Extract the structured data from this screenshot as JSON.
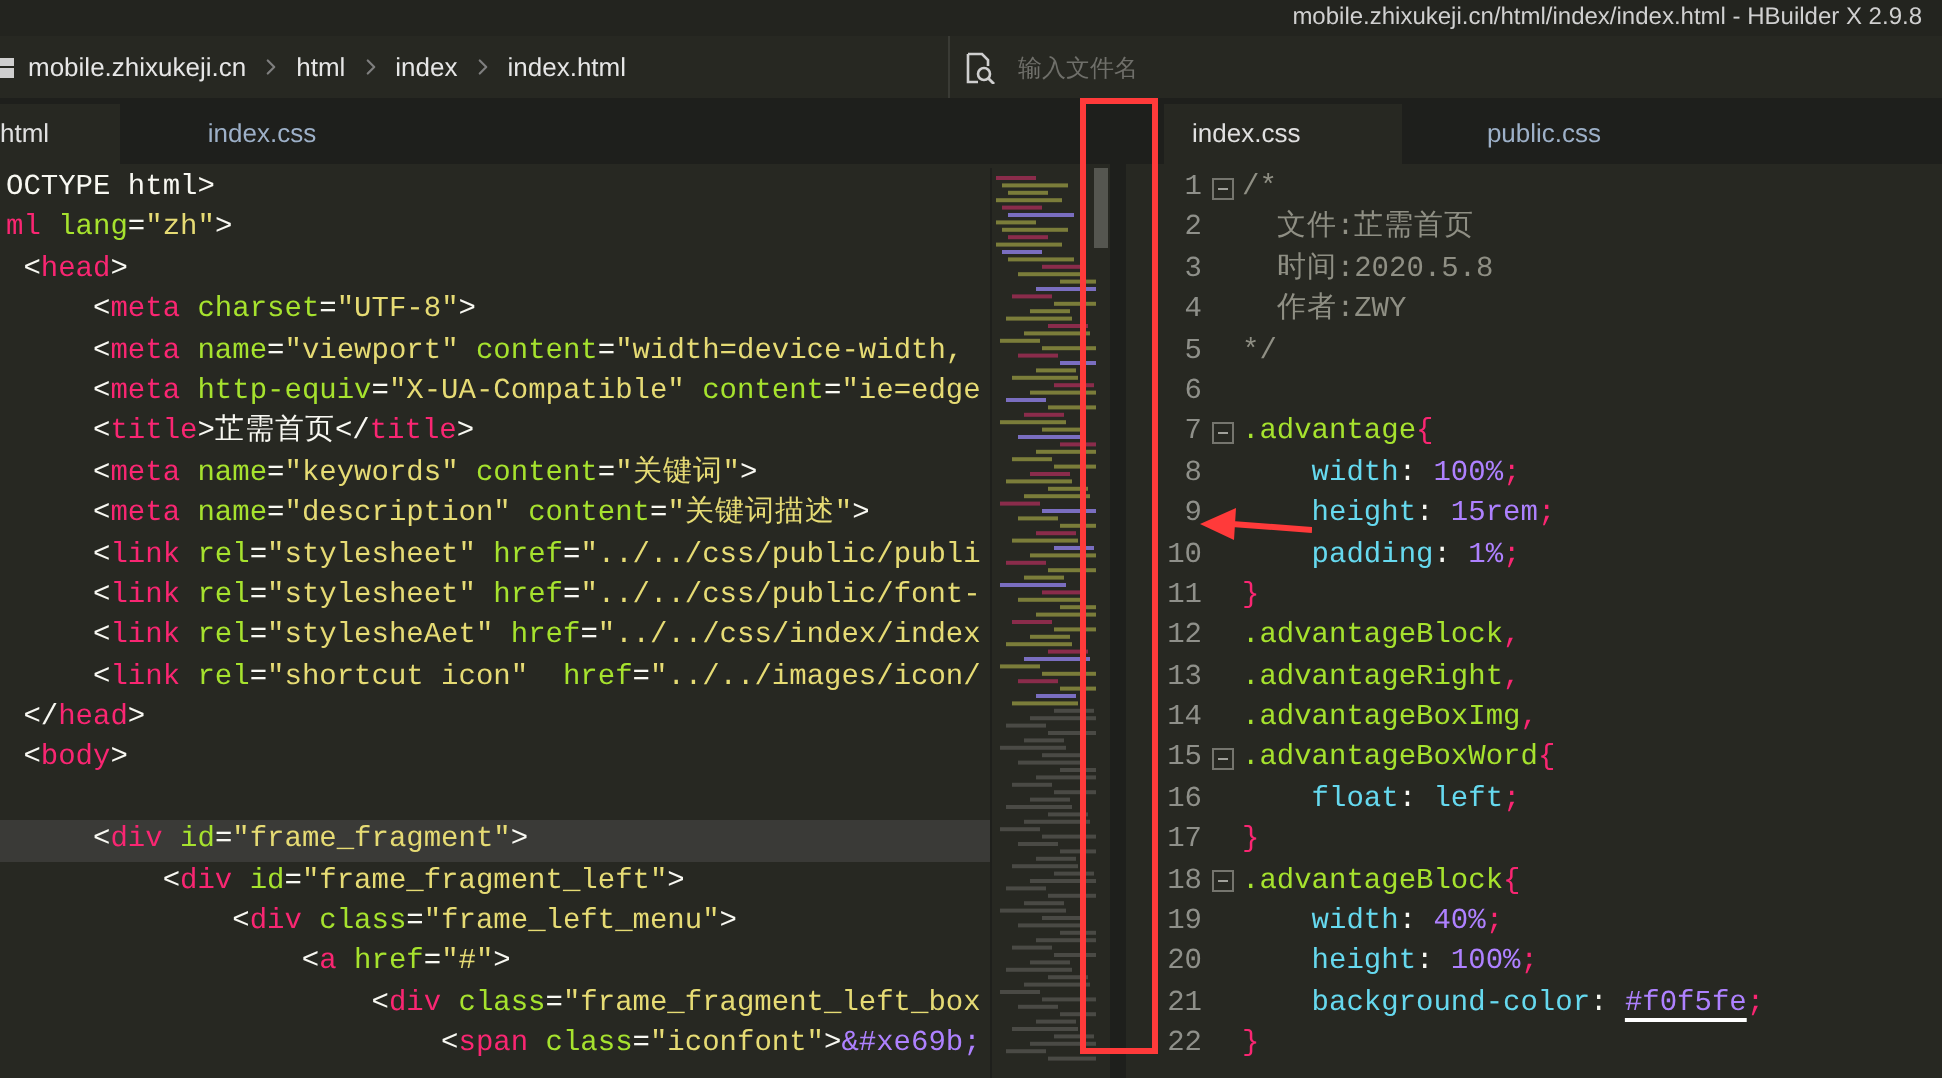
{
  "window": {
    "title": "mobile.zhixukeji.cn/html/index/index.html - HBuilder X 2.9.8"
  },
  "breadcrumb": {
    "items": [
      "mobile.zhixukeji.cn",
      "html",
      "index",
      "index.html"
    ]
  },
  "file_search": {
    "placeholder": "输入文件名"
  },
  "left_editor": {
    "tabs": [
      {
        "label": "html",
        "selected": true
      },
      {
        "label": "index.css",
        "selected": false
      }
    ],
    "lines": [
      {
        "current": false,
        "tokens": [
          {
            "kind": "txt",
            "text": "OCTYPE html>"
          }
        ]
      },
      {
        "current": false,
        "tokens": [
          {
            "kind": "tag",
            "text": "ml"
          },
          {
            "kind": "attr",
            "text": " lang"
          },
          {
            "kind": "p",
            "text": "="
          },
          {
            "kind": "str",
            "text": "\"zh\""
          },
          {
            "kind": "p",
            "text": ">"
          }
        ]
      },
      {
        "current": false,
        "tokens": [
          {
            "kind": "p",
            "text": " <"
          },
          {
            "kind": "tag",
            "text": "head"
          },
          {
            "kind": "p",
            "text": ">"
          }
        ]
      },
      {
        "current": false,
        "tokens": [
          {
            "kind": "p",
            "text": "     <"
          },
          {
            "kind": "tag",
            "text": "meta"
          },
          {
            "kind": "attr",
            "text": " charset"
          },
          {
            "kind": "p",
            "text": "="
          },
          {
            "kind": "str",
            "text": "\"UTF-8\""
          },
          {
            "kind": "p",
            "text": ">"
          }
        ]
      },
      {
        "current": false,
        "tokens": [
          {
            "kind": "p",
            "text": "     <"
          },
          {
            "kind": "tag",
            "text": "meta"
          },
          {
            "kind": "attr",
            "text": " name"
          },
          {
            "kind": "p",
            "text": "="
          },
          {
            "kind": "str",
            "text": "\"viewport\""
          },
          {
            "kind": "attr",
            "text": " content"
          },
          {
            "kind": "p",
            "text": "="
          },
          {
            "kind": "str",
            "text": "\"width=device-width,"
          }
        ]
      },
      {
        "current": false,
        "tokens": [
          {
            "kind": "p",
            "text": "     <"
          },
          {
            "kind": "tag",
            "text": "meta"
          },
          {
            "kind": "attr",
            "text": " http-equiv"
          },
          {
            "kind": "p",
            "text": "="
          },
          {
            "kind": "str",
            "text": "\"X-UA-Compatible\""
          },
          {
            "kind": "attr",
            "text": " content"
          },
          {
            "kind": "p",
            "text": "="
          },
          {
            "kind": "str",
            "text": "\"ie=edge"
          }
        ]
      },
      {
        "current": false,
        "tokens": [
          {
            "kind": "p",
            "text": "     <"
          },
          {
            "kind": "tag",
            "text": "title"
          },
          {
            "kind": "p",
            "text": ">"
          },
          {
            "kind": "txt",
            "text": "芷需首页"
          },
          {
            "kind": "p",
            "text": "</"
          },
          {
            "kind": "tag",
            "text": "title"
          },
          {
            "kind": "p",
            "text": ">"
          }
        ]
      },
      {
        "current": false,
        "tokens": [
          {
            "kind": "p",
            "text": "     <"
          },
          {
            "kind": "tag",
            "text": "meta"
          },
          {
            "kind": "attr",
            "text": " name"
          },
          {
            "kind": "p",
            "text": "="
          },
          {
            "kind": "str",
            "text": "\"keywords\""
          },
          {
            "kind": "attr",
            "text": " content"
          },
          {
            "kind": "p",
            "text": "="
          },
          {
            "kind": "str",
            "text": "\"关键词\""
          },
          {
            "kind": "p",
            "text": ">"
          }
        ]
      },
      {
        "current": false,
        "tokens": [
          {
            "kind": "p",
            "text": "     <"
          },
          {
            "kind": "tag",
            "text": "meta"
          },
          {
            "kind": "attr",
            "text": " name"
          },
          {
            "kind": "p",
            "text": "="
          },
          {
            "kind": "str",
            "text": "\"description\""
          },
          {
            "kind": "attr",
            "text": " content"
          },
          {
            "kind": "p",
            "text": "="
          },
          {
            "kind": "str",
            "text": "\"关键词描述\""
          },
          {
            "kind": "p",
            "text": ">"
          }
        ]
      },
      {
        "current": false,
        "tokens": [
          {
            "kind": "p",
            "text": "     <"
          },
          {
            "kind": "tag",
            "text": "link"
          },
          {
            "kind": "attr",
            "text": " rel"
          },
          {
            "kind": "p",
            "text": "="
          },
          {
            "kind": "str",
            "text": "\"stylesheet\""
          },
          {
            "kind": "attr",
            "text": " href"
          },
          {
            "kind": "p",
            "text": "="
          },
          {
            "kind": "str",
            "text": "\"../../css/public/publi"
          }
        ]
      },
      {
        "current": false,
        "tokens": [
          {
            "kind": "p",
            "text": "     <"
          },
          {
            "kind": "tag",
            "text": "link"
          },
          {
            "kind": "attr",
            "text": " rel"
          },
          {
            "kind": "p",
            "text": "="
          },
          {
            "kind": "str",
            "text": "\"stylesheet\""
          },
          {
            "kind": "attr",
            "text": " href"
          },
          {
            "kind": "p",
            "text": "="
          },
          {
            "kind": "str",
            "text": "\"../../css/public/font-"
          }
        ]
      },
      {
        "current": false,
        "tokens": [
          {
            "kind": "p",
            "text": "     <"
          },
          {
            "kind": "tag",
            "text": "link"
          },
          {
            "kind": "attr",
            "text": " rel"
          },
          {
            "kind": "p",
            "text": "="
          },
          {
            "kind": "str",
            "text": "\"stylesheAet\""
          },
          {
            "kind": "attr",
            "text": " href"
          },
          {
            "kind": "p",
            "text": "="
          },
          {
            "kind": "str",
            "text": "\"../../css/index/index"
          }
        ]
      },
      {
        "current": false,
        "tokens": [
          {
            "kind": "p",
            "text": "     <"
          },
          {
            "kind": "tag",
            "text": "link"
          },
          {
            "kind": "attr",
            "text": " rel"
          },
          {
            "kind": "p",
            "text": "="
          },
          {
            "kind": "str",
            "text": "\"shortcut icon\""
          },
          {
            "kind": "attr",
            "text": "  href"
          },
          {
            "kind": "p",
            "text": "="
          },
          {
            "kind": "str",
            "text": "\"../../images/icon/"
          }
        ]
      },
      {
        "current": false,
        "tokens": [
          {
            "kind": "p",
            "text": " </"
          },
          {
            "kind": "tag",
            "text": "head"
          },
          {
            "kind": "p",
            "text": ">"
          }
        ]
      },
      {
        "current": false,
        "tokens": [
          {
            "kind": "p",
            "text": " <"
          },
          {
            "kind": "tag",
            "text": "body"
          },
          {
            "kind": "p",
            "text": ">"
          }
        ]
      },
      {
        "current": false
      },
      {
        "current": true,
        "tokens": [
          {
            "kind": "p",
            "text": "     <"
          },
          {
            "kind": "tag",
            "text": "div"
          },
          {
            "kind": "attr",
            "text": " id"
          },
          {
            "kind": "p",
            "text": "="
          },
          {
            "kind": "str",
            "text": "\"frame_fragment\""
          },
          {
            "kind": "p",
            "text": ">"
          }
        ]
      },
      {
        "current": false,
        "tokens": [
          {
            "kind": "p",
            "text": "         <"
          },
          {
            "kind": "tag",
            "text": "div"
          },
          {
            "kind": "attr",
            "text": " id"
          },
          {
            "kind": "p",
            "text": "="
          },
          {
            "kind": "str",
            "text": "\"frame_fragment_left\""
          },
          {
            "kind": "p",
            "text": ">"
          }
        ]
      },
      {
        "current": false,
        "tokens": [
          {
            "kind": "p",
            "text": "             <"
          },
          {
            "kind": "tag",
            "text": "div"
          },
          {
            "kind": "attr",
            "text": " class"
          },
          {
            "kind": "p",
            "text": "="
          },
          {
            "kind": "str",
            "text": "\"frame_left_menu\""
          },
          {
            "kind": "p",
            "text": ">"
          }
        ]
      },
      {
        "current": false,
        "tokens": [
          {
            "kind": "p",
            "text": "                 <"
          },
          {
            "kind": "tag",
            "text": "a"
          },
          {
            "kind": "attr",
            "text": " href"
          },
          {
            "kind": "p",
            "text": "="
          },
          {
            "kind": "str",
            "text": "\"#\""
          },
          {
            "kind": "p",
            "text": ">"
          }
        ]
      },
      {
        "current": false,
        "tokens": [
          {
            "kind": "p",
            "text": "                     <"
          },
          {
            "kind": "tag",
            "text": "div"
          },
          {
            "kind": "attr",
            "text": " class"
          },
          {
            "kind": "p",
            "text": "="
          },
          {
            "kind": "str",
            "text": "\"frame_fragment_left_box"
          }
        ]
      },
      {
        "current": false,
        "tokens": [
          {
            "kind": "p",
            "text": "                         <"
          },
          {
            "kind": "tag",
            "text": "span"
          },
          {
            "kind": "attr",
            "text": " class"
          },
          {
            "kind": "p",
            "text": "="
          },
          {
            "kind": "str",
            "text": "\"iconfont\""
          },
          {
            "kind": "p",
            "text": ">"
          },
          {
            "kind": "num",
            "text": "&#xe69b;"
          }
        ]
      }
    ]
  },
  "right_editor": {
    "tabs": [
      {
        "label": "index.css",
        "selected": true
      },
      {
        "label": "public.css",
        "selected": false
      }
    ],
    "lines": [
      {
        "number": "1",
        "fold": true,
        "tokens": [
          {
            "kind": "comment",
            "text": "/*"
          }
        ]
      },
      {
        "number": "2",
        "fold": false,
        "tokens": [
          {
            "kind": "comment",
            "text": "  文件:芷需首页"
          }
        ]
      },
      {
        "number": "3",
        "fold": false,
        "tokens": [
          {
            "kind": "comment",
            "text": "  时间:2020.5.8"
          }
        ]
      },
      {
        "number": "4",
        "fold": false,
        "tokens": [
          {
            "kind": "comment",
            "text": "  作者:ZWY"
          }
        ]
      },
      {
        "number": "5",
        "fold": false,
        "tokens": [
          {
            "kind": "comment",
            "text": "*/"
          }
        ]
      },
      {
        "number": "6",
        "fold": false
      },
      {
        "number": "7",
        "fold": true,
        "tokens": [
          {
            "kind": "sel",
            "text": ".advantage"
          },
          {
            "kind": "brace",
            "text": "{"
          }
        ]
      },
      {
        "number": "8",
        "fold": false,
        "tokens": [
          {
            "kind": "prop",
            "text": "    width"
          },
          {
            "kind": "p",
            "text": ": "
          },
          {
            "kind": "num",
            "text": "100%"
          },
          {
            "kind": "brace",
            "text": ";"
          }
        ]
      },
      {
        "number": "9",
        "fold": false,
        "tokens": [
          {
            "kind": "prop",
            "text": "    height"
          },
          {
            "kind": "p",
            "text": ": "
          },
          {
            "kind": "num",
            "text": "15rem"
          },
          {
            "kind": "brace",
            "text": ";"
          }
        ]
      },
      {
        "number": "10",
        "fold": false,
        "tokens": [
          {
            "kind": "prop",
            "text": "    padding"
          },
          {
            "kind": "p",
            "text": ": "
          },
          {
            "kind": "num",
            "text": "1%"
          },
          {
            "kind": "brace",
            "text": ";"
          }
        ]
      },
      {
        "number": "11",
        "fold": false,
        "tokens": [
          {
            "kind": "brace",
            "text": "}"
          }
        ]
      },
      {
        "number": "12",
        "fold": false,
        "tokens": [
          {
            "kind": "sel",
            "text": ".advantageBlock"
          },
          {
            "kind": "brace",
            "text": ","
          }
        ]
      },
      {
        "number": "13",
        "fold": false,
        "tokens": [
          {
            "kind": "sel",
            "text": ".advantageRight"
          },
          {
            "kind": "brace",
            "text": ","
          }
        ]
      },
      {
        "number": "14",
        "fold": false,
        "tokens": [
          {
            "kind": "sel",
            "text": ".advantageBoxImg"
          },
          {
            "kind": "brace",
            "text": ","
          }
        ]
      },
      {
        "number": "15",
        "fold": true,
        "tokens": [
          {
            "kind": "sel",
            "text": ".advantageBoxWord"
          },
          {
            "kind": "brace",
            "text": "{"
          }
        ]
      },
      {
        "number": "16",
        "fold": false,
        "tokens": [
          {
            "kind": "prop",
            "text": "    float"
          },
          {
            "kind": "p",
            "text": ": "
          },
          {
            "kind": "kw",
            "text": "left"
          },
          {
            "kind": "brace",
            "text": ";"
          }
        ]
      },
      {
        "number": "17",
        "fold": false,
        "tokens": [
          {
            "kind": "brace",
            "text": "}"
          }
        ]
      },
      {
        "number": "18",
        "fold": true,
        "tokens": [
          {
            "kind": "sel",
            "text": ".advantageBlock"
          },
          {
            "kind": "brace",
            "text": "{"
          }
        ]
      },
      {
        "number": "19",
        "fold": false,
        "tokens": [
          {
            "kind": "prop",
            "text": "    width"
          },
          {
            "kind": "p",
            "text": ": "
          },
          {
            "kind": "num",
            "text": "40%"
          },
          {
            "kind": "brace",
            "text": ";"
          }
        ]
      },
      {
        "number": "20",
        "fold": false,
        "tokens": [
          {
            "kind": "prop",
            "text": "    height"
          },
          {
            "kind": "p",
            "text": ": "
          },
          {
            "kind": "num",
            "text": "100%"
          },
          {
            "kind": "brace",
            "text": ";"
          }
        ]
      },
      {
        "number": "21",
        "fold": false,
        "tokens": [
          {
            "kind": "prop",
            "text": "    background-color"
          },
          {
            "kind": "p",
            "text": ": "
          },
          {
            "kind": "color",
            "text": "#f0f5fe"
          },
          {
            "kind": "brace",
            "text": ";"
          }
        ]
      },
      {
        "number": "22",
        "fold": false,
        "tokens": [
          {
            "kind": "brace",
            "text": "}"
          }
        ]
      }
    ]
  }
}
